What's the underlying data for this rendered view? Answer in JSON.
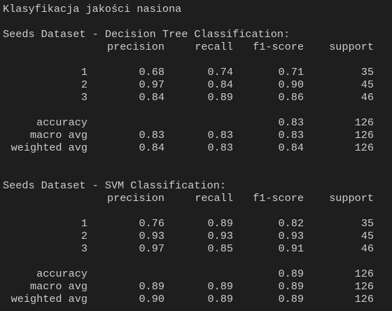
{
  "title": "Klasyfikacja jakości nasiona",
  "headers": {
    "precision": "precision",
    "recall": "recall",
    "f1": "f1-score",
    "support": "support"
  },
  "reports": [
    {
      "heading": "Seeds Dataset - Decision Tree Classification:",
      "classes": [
        {
          "label": "1",
          "precision": "0.68",
          "recall": "0.74",
          "f1": "0.71",
          "support": "35"
        },
        {
          "label": "2",
          "precision": "0.97",
          "recall": "0.84",
          "f1": "0.90",
          "support": "45"
        },
        {
          "label": "3",
          "precision": "0.84",
          "recall": "0.89",
          "f1": "0.86",
          "support": "46"
        }
      ],
      "summary": [
        {
          "label": "accuracy",
          "precision": "",
          "recall": "",
          "f1": "0.83",
          "support": "126"
        },
        {
          "label": "macro avg",
          "precision": "0.83",
          "recall": "0.83",
          "f1": "0.83",
          "support": "126"
        },
        {
          "label": "weighted avg",
          "precision": "0.84",
          "recall": "0.83",
          "f1": "0.84",
          "support": "126"
        }
      ]
    },
    {
      "heading": "Seeds Dataset - SVM Classification:",
      "classes": [
        {
          "label": "1",
          "precision": "0.76",
          "recall": "0.89",
          "f1": "0.82",
          "support": "35"
        },
        {
          "label": "2",
          "precision": "0.93",
          "recall": "0.93",
          "f1": "0.93",
          "support": "45"
        },
        {
          "label": "3",
          "precision": "0.97",
          "recall": "0.85",
          "f1": "0.91",
          "support": "46"
        }
      ],
      "summary": [
        {
          "label": "accuracy",
          "precision": "",
          "recall": "",
          "f1": "0.89",
          "support": "126"
        },
        {
          "label": "macro avg",
          "precision": "0.89",
          "recall": "0.89",
          "f1": "0.89",
          "support": "126"
        },
        {
          "label": "weighted avg",
          "precision": "0.90",
          "recall": "0.89",
          "f1": "0.89",
          "support": "126"
        }
      ]
    }
  ],
  "colors": {
    "background": "#1e1e1e",
    "text": "#cccccc"
  }
}
